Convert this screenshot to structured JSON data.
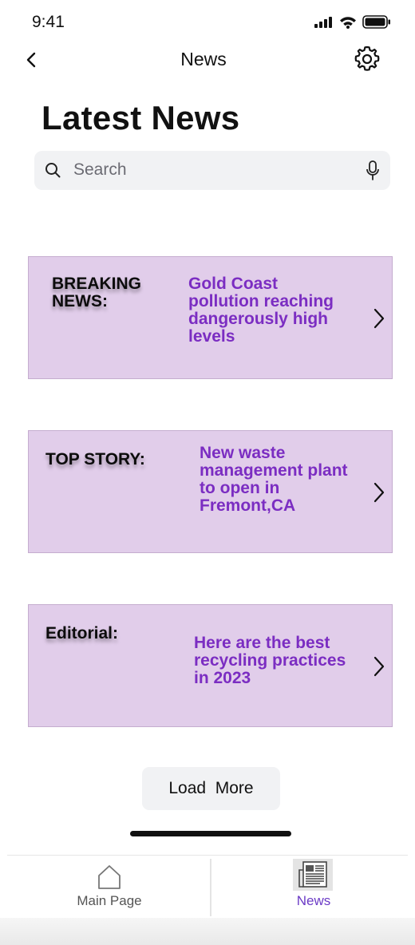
{
  "status_bar": {
    "time": "9:41"
  },
  "nav": {
    "title": "News"
  },
  "page": {
    "title": "Latest News"
  },
  "search": {
    "placeholder": "Search"
  },
  "cards": [
    {
      "label_lines": [
        "BREAKING",
        "NEWS:"
      ],
      "headline_lines": [
        "Gold Coast",
        "pollution reaching",
        "dangerously high",
        "levels"
      ]
    },
    {
      "label_lines": [
        "TOP STORY:"
      ],
      "headline_lines": [
        "New waste",
        "management plant",
        "to open in",
        "Fremont,CA"
      ]
    },
    {
      "label_lines": [
        "Editorial:"
      ],
      "headline_lines": [
        "Here are the best",
        "recycling practices",
        "in 2023"
      ]
    }
  ],
  "load_more": {
    "label": "Load  More"
  },
  "tabbar": {
    "items": [
      {
        "label": "Main Page",
        "active": false
      },
      {
        "label": "News",
        "active": true
      }
    ],
    "active_color": "#6b3bc6"
  },
  "colors": {
    "card_bg": "#e1cdea",
    "headline": "#7b2dc2"
  }
}
